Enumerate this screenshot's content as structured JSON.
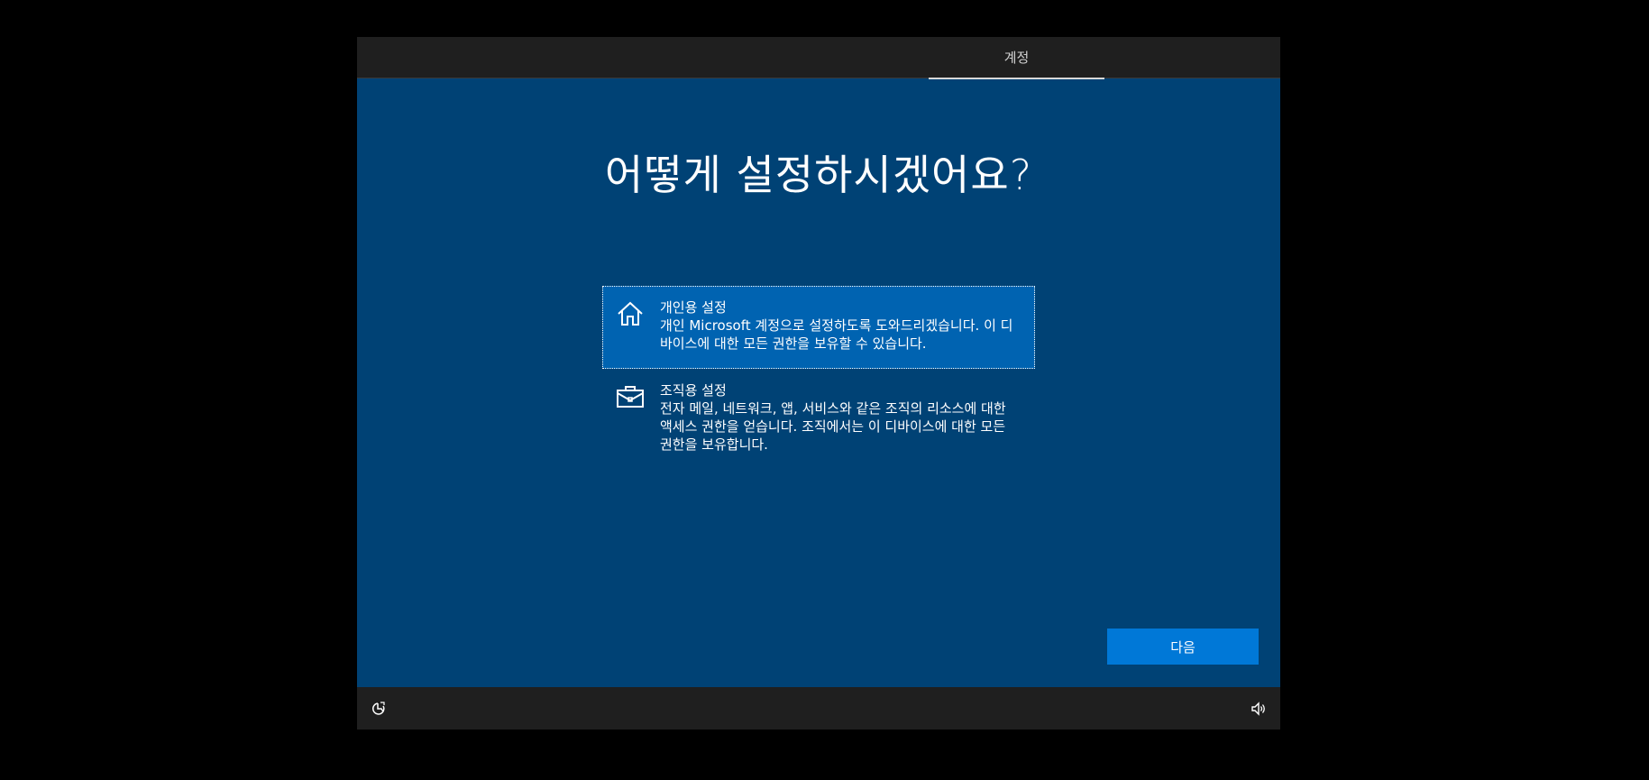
{
  "header": {
    "tab_label": "계정"
  },
  "main": {
    "title": "어떻게 설정하시겠어요?",
    "options": [
      {
        "title": "개인용 설정",
        "description": "개인 Microsoft 계정으로 설정하도록 도와드리겠습니다. 이 디바이스에 대한 모든 권한을 보유할 수 있습니다.",
        "icon": "home-icon",
        "selected": true
      },
      {
        "title": "조직용 설정",
        "description": "전자 메일, 네트워크, 앱, 서비스와 같은 조직의 리소스에 대한 액세스 권한을 얻습니다. 조직에서는 이 디바이스에 대한 모든 권한을 보유합니다.",
        "icon": "briefcase-icon",
        "selected": false
      }
    ],
    "next_label": "다음"
  },
  "footer": {
    "left_icon": "accessibility-icon",
    "right_icon": "volume-icon"
  },
  "colors": {
    "background": "#004275",
    "selected_option": "#0063b1",
    "button": "#0078d7",
    "bars": "#1f1f1f"
  }
}
